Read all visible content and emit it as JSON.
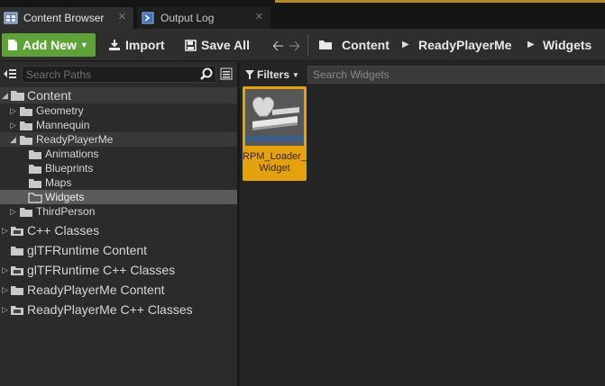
{
  "tabs": [
    {
      "label": "Content Browser",
      "icon": "content-browser-icon",
      "close": "✕"
    },
    {
      "label": "Output Log",
      "icon": "output-log-icon",
      "close": "✕"
    }
  ],
  "toolbar": {
    "add_new": "Add New",
    "import": "Import",
    "save_all": "Save All"
  },
  "breadcrumb": [
    "Content",
    "ReadyPlayerMe",
    "Widgets"
  ],
  "sources": {
    "search_placeholder": "Search Paths",
    "tree": [
      {
        "label": "Content"
      },
      {
        "label": "Geometry"
      },
      {
        "label": "Mannequin"
      },
      {
        "label": "ReadyPlayerMe"
      },
      {
        "label": "Animations"
      },
      {
        "label": "Blueprints"
      },
      {
        "label": "Maps"
      },
      {
        "label": "Widgets"
      },
      {
        "label": "ThirdPerson"
      },
      {
        "label": "C++ Classes"
      },
      {
        "label": "glTFRuntime Content"
      },
      {
        "label": "glTFRuntime C++ Classes"
      },
      {
        "label": "ReadyPlayerMe Content"
      },
      {
        "label": "ReadyPlayerMe C++ Classes"
      }
    ]
  },
  "assets": {
    "filters_label": "Filters",
    "search_placeholder": "Search Widgets",
    "items": [
      {
        "line1": "RPM_Loader_",
        "line2": "Widget"
      }
    ]
  },
  "colors": {
    "add_new_green": "#5fa23a",
    "selection_orange": "#e6a10f",
    "accent_gold": "#b38a2a"
  }
}
